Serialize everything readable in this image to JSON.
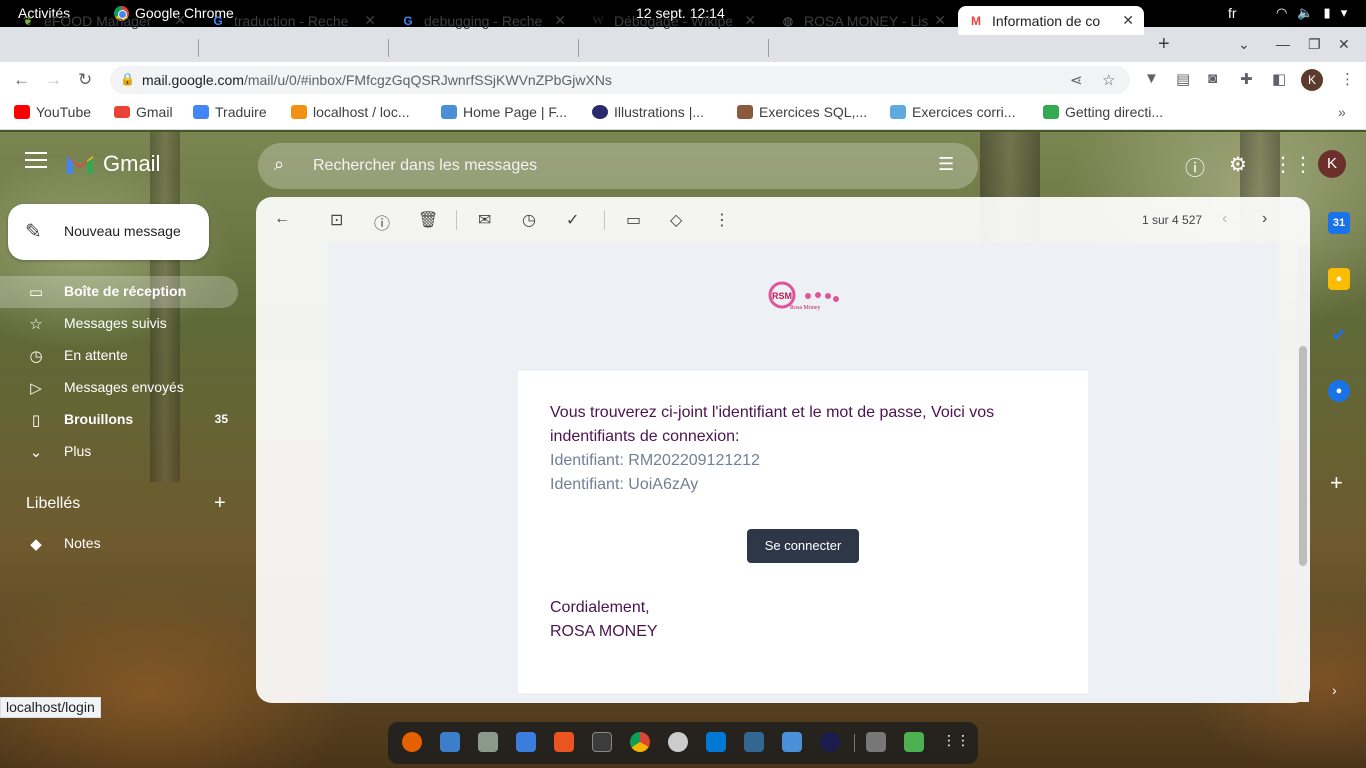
{
  "system": {
    "activities": "Activités",
    "app_name": "Google Chrome",
    "clock": "12 sept.  12:14",
    "lang": "fr"
  },
  "tabs": [
    {
      "title": "eFOOD Manager",
      "icon": "efood-icon"
    },
    {
      "title": "traduction - Reche",
      "icon": "google-icon"
    },
    {
      "title": "debugging - Reche",
      "icon": "google-icon"
    },
    {
      "title": "Débogage - Wikipe",
      "icon": "wikipedia-icon"
    },
    {
      "title": "ROSA MONEY - Lis",
      "icon": "globe-icon"
    },
    {
      "title": "Information de co",
      "icon": "gmail-icon",
      "active": true
    }
  ],
  "address_bar": {
    "host": "mail.google.com",
    "path": "/mail/u/0/#inbox/FMfcgzGqQSRJwnrfSSjKWVnZPbGjwXNs"
  },
  "bookmarks": [
    {
      "label": "YouTube",
      "color": "#ff0000"
    },
    {
      "label": "Gmail",
      "color": "#ea4335"
    },
    {
      "label": "Traduire",
      "color": "#4285f4"
    },
    {
      "label": "localhost / loc...",
      "color": "#f29111"
    },
    {
      "label": "Home Page | F...",
      "color": "#4a90d9"
    },
    {
      "label": "Illustrations |...",
      "color": "#2b2b6b"
    },
    {
      "label": "Exercices SQL,...",
      "color": "#8b5a3c"
    },
    {
      "label": "Exercices corri...",
      "color": "#5fa8e0"
    },
    {
      "label": "Getting directi...",
      "color": "#34a853"
    }
  ],
  "gmail": {
    "logo_text": "Gmail",
    "search_placeholder": "Rechercher dans les messages",
    "profile_initial": "K",
    "compose_label": "Nouveau message",
    "nav": [
      {
        "label": "Boîte de réception",
        "icon": "inbox-icon",
        "count": ""
      },
      {
        "label": "Messages suivis",
        "icon": "star-icon",
        "count": ""
      },
      {
        "label": "En attente",
        "icon": "clock-icon",
        "count": ""
      },
      {
        "label": "Messages envoyés",
        "icon": "send-icon",
        "count": ""
      },
      {
        "label": "Brouillons",
        "icon": "draft-icon",
        "count": "35"
      },
      {
        "label": "Plus",
        "icon": "chevron-down-icon",
        "count": ""
      }
    ],
    "labels_heading": "Libellés",
    "labels": [
      {
        "label": "Notes",
        "icon": "label-icon"
      }
    ],
    "pager": "1 sur 4 527"
  },
  "email": {
    "brand_logo_text": "RSM",
    "brand_logo_sub": "Rosa Money",
    "intro": "Vous trouverez ci-joint l'identifiant et le mot de passe, Voici vos indentifiants de connexion:",
    "identifiant_line": "Identifiant: RM202209121212",
    "password_line": "Identifiant: UoiA6zAy",
    "button": "Se connecter",
    "sign_off": "Cordialement,",
    "signature": "ROSA MONEY"
  },
  "status_url": "localhost/login",
  "colors": {
    "email_text": "#4a1450",
    "credential_text": "#718096",
    "button_bg": "#2d3748"
  }
}
